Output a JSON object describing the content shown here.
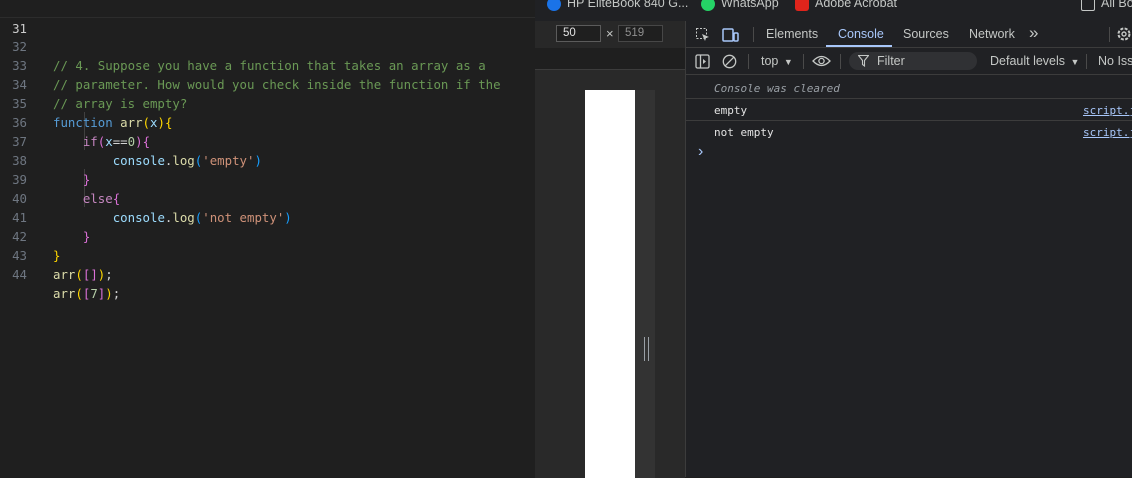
{
  "editor": {
    "lines": [
      {
        "num": "31",
        "tokens": []
      },
      {
        "num": "32",
        "tokens": [
          {
            "c": "cm",
            "t": "// 4. Suppose you have a function that takes an array as a"
          }
        ]
      },
      {
        "num": "33",
        "tokens": [
          {
            "c": "cm",
            "t": "// parameter. How would you check inside the function if the"
          }
        ]
      },
      {
        "num": "34",
        "tokens": [
          {
            "c": "cm",
            "t": "// array is empty?"
          }
        ]
      },
      {
        "num": "35",
        "tokens": [
          {
            "c": "kw",
            "t": "function"
          },
          {
            "c": "op",
            "t": " "
          },
          {
            "c": "fn",
            "t": "arr"
          },
          {
            "c": "b1",
            "t": "("
          },
          {
            "c": "pm",
            "t": "x"
          },
          {
            "c": "b1",
            "t": ")"
          },
          {
            "c": "b1",
            "t": "{"
          }
        ]
      },
      {
        "num": "36",
        "tokens": [
          {
            "c": "op",
            "t": "    "
          },
          {
            "c": "ctl",
            "t": "if"
          },
          {
            "c": "b2",
            "t": "("
          },
          {
            "c": "pm",
            "t": "x"
          },
          {
            "c": "op",
            "t": "=="
          },
          {
            "c": "num",
            "t": "0"
          },
          {
            "c": "b2",
            "t": ")"
          },
          {
            "c": "b2",
            "t": "{"
          }
        ]
      },
      {
        "num": "37",
        "tokens": [
          {
            "c": "op",
            "t": "        "
          },
          {
            "c": "pm",
            "t": "console"
          },
          {
            "c": "op",
            "t": "."
          },
          {
            "c": "fn",
            "t": "log"
          },
          {
            "c": "b3",
            "t": "("
          },
          {
            "c": "str",
            "t": "'empty'"
          },
          {
            "c": "b3",
            "t": ")"
          }
        ]
      },
      {
        "num": "38",
        "tokens": [
          {
            "c": "op",
            "t": "    "
          },
          {
            "c": "b2",
            "t": "}"
          }
        ]
      },
      {
        "num": "39",
        "tokens": [
          {
            "c": "op",
            "t": "    "
          },
          {
            "c": "ctl",
            "t": "else"
          },
          {
            "c": "b2",
            "t": "{"
          }
        ]
      },
      {
        "num": "40",
        "tokens": [
          {
            "c": "op",
            "t": "        "
          },
          {
            "c": "pm",
            "t": "console"
          },
          {
            "c": "op",
            "t": "."
          },
          {
            "c": "fn",
            "t": "log"
          },
          {
            "c": "b3",
            "t": "("
          },
          {
            "c": "str",
            "t": "'not empty'"
          },
          {
            "c": "b3",
            "t": ")"
          }
        ]
      },
      {
        "num": "41",
        "tokens": [
          {
            "c": "op",
            "t": "    "
          },
          {
            "c": "b2",
            "t": "}"
          }
        ]
      },
      {
        "num": "42",
        "tokens": [
          {
            "c": "b1",
            "t": "}"
          }
        ]
      },
      {
        "num": "43",
        "tokens": [
          {
            "c": "fn",
            "t": "arr"
          },
          {
            "c": "b1",
            "t": "("
          },
          {
            "c": "b2",
            "t": "["
          },
          {
            "c": "b2",
            "t": "]"
          },
          {
            "c": "b1",
            "t": ")"
          },
          {
            "c": "op",
            "t": ";"
          }
        ]
      },
      {
        "num": "44",
        "tokens": [
          {
            "c": "fn",
            "t": "arr"
          },
          {
            "c": "b1",
            "t": "("
          },
          {
            "c": "b2",
            "t": "["
          },
          {
            "c": "num",
            "t": "7"
          },
          {
            "c": "b2",
            "t": "]"
          },
          {
            "c": "b1",
            "t": ")"
          },
          {
            "c": "op",
            "t": ";"
          }
        ]
      }
    ]
  },
  "bookmarks": {
    "items": [
      {
        "label": "HP EliteBook 840 G...",
        "icon": "hp-icon"
      },
      {
        "label": "WhatsApp",
        "icon": "whatsapp-icon"
      },
      {
        "label": "Adobe Acrobat",
        "icon": "acrobat-icon"
      },
      {
        "label": "All Bo",
        "icon": "folder-icon"
      }
    ]
  },
  "device": {
    "width": "50",
    "height": "519",
    "times": "×"
  },
  "devtools": {
    "tabs": {
      "elements": "Elements",
      "console": "Console",
      "sources": "Sources",
      "network": "Network",
      "more": "»"
    },
    "toolbar": {
      "context": "top",
      "filter_placeholder": "Filter",
      "levels": "Default levels",
      "issues": "No Issu"
    },
    "console": {
      "cleared": "Console was cleared",
      "messages": [
        {
          "text": "empty",
          "source": "script.js"
        },
        {
          "text": "not empty",
          "source": "script.js"
        }
      ],
      "prompt": "›"
    },
    "colors": {
      "accent": "#a8c7fa",
      "background": "#202124"
    }
  }
}
